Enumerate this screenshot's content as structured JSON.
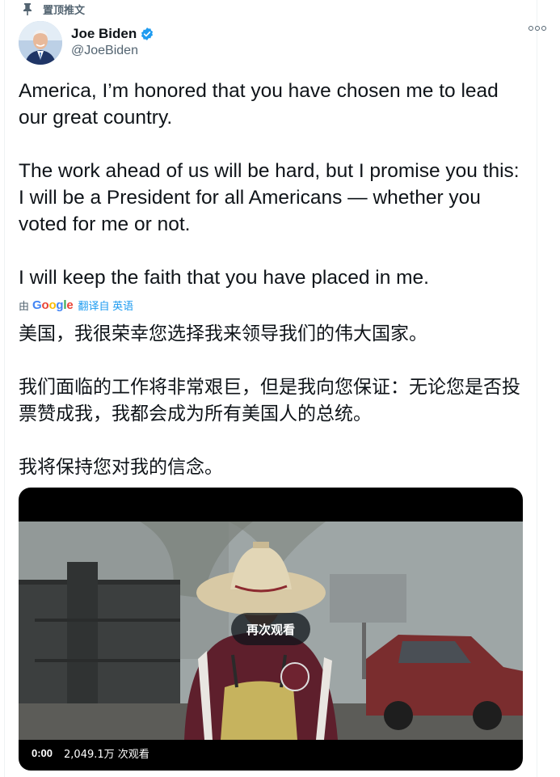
{
  "pinned_label": "置顶推文",
  "author": {
    "name": "Joe Biden",
    "handle": "@JoeBiden"
  },
  "tweet": {
    "paragraphs": [
      "America, I’m honored that you have chosen me to lead our great country.",
      "The work ahead of us will be hard, but I promise you this: I will be a President for all Americans — whether you voted for me or not.",
      "I will keep the faith that you have placed in me."
    ]
  },
  "translation": {
    "by_label": "由",
    "provider": "Google",
    "link": "翻译自 英语",
    "paragraphs": [
      "美国，我很荣幸您选择我来领导我们的伟大国家。",
      "我们面临的工作将非常艰巨，但是我向您保证：无论您是否投票赞成我，我都会成为所有美国人的总统。",
      "我将保持您对我的信念。"
    ]
  },
  "video": {
    "replay_label": "再次观看",
    "time": "0:00",
    "views": "2,049.1万 次观看"
  },
  "colors": {
    "accent": "#1d9bf0",
    "secondary_text": "#536471",
    "primary_text": "#0f1419"
  }
}
